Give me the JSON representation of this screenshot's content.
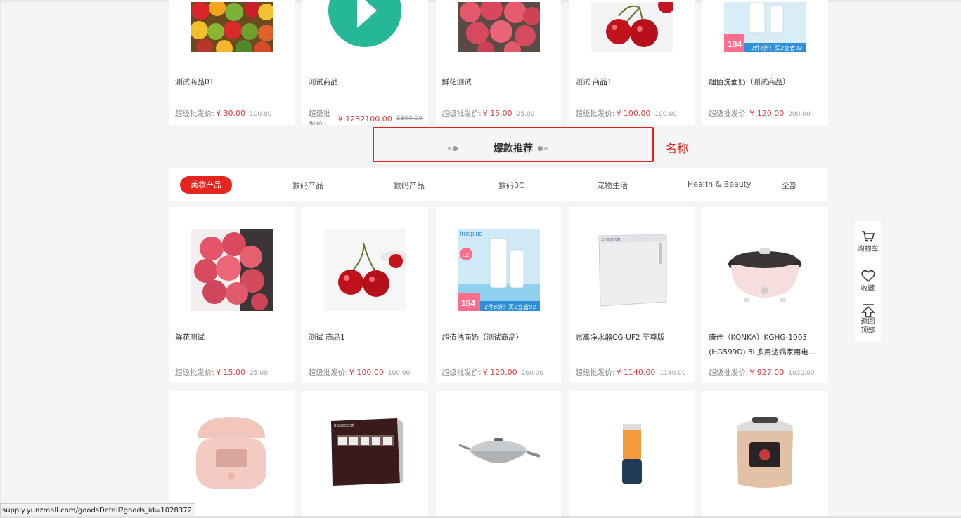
{
  "section": {
    "title": "爆款推荐",
    "annotation": "名称"
  },
  "tabs": [
    "美妆产品",
    "数码产品",
    "数码产品",
    "数码3C",
    "宠物生活",
    "Health & Beauty",
    "全部"
  ],
  "top_products": [
    {
      "name": "测试商品01",
      "label": "超级批发价:",
      "price": "¥ 30.00",
      "old": "100.00",
      "image": "fruits"
    },
    {
      "name": "测试商品",
      "label": "超级批发价:",
      "price": "¥ 1232100.00",
      "old": "1300.00",
      "image": "play-icon"
    },
    {
      "name": "鲜花测试",
      "label": "超级批发价:",
      "price": "¥ 15.00",
      "old": "25.00",
      "image": "flowers"
    },
    {
      "name": "测试 商品1",
      "label": "超级批发价:",
      "price": "¥ 100.00",
      "old": "100.00",
      "image": "cherries"
    },
    {
      "name": "超值洗面奶（测试商品）",
      "label": "超级批发价:",
      "price": "¥ 120.00",
      "old": "200.00",
      "image": "cleanser"
    }
  ],
  "recommended": [
    {
      "name": "鲜花测试",
      "label": "超级批发价:",
      "price": "¥ 15.00",
      "old": "25.00",
      "image": "flowers"
    },
    {
      "name": "测试 商品1",
      "label": "超级批发价:",
      "price": "¥ 100.00",
      "old": "100.00",
      "image": "cherries"
    },
    {
      "name": "超值洗面奶（测试商品）",
      "label": "超级批发价:",
      "price": "¥ 120.00",
      "old": "200.00",
      "image": "cleanser"
    },
    {
      "name": "志高净水器CG-UF2 至尊版",
      "label": "超级批发价:",
      "price": "¥ 1140.00",
      "old": "1140.00",
      "image": "water-purifier"
    },
    {
      "name": "康佳（KONKA）KGHG-1003 (HG599D) 3L多用途锅家用电...",
      "label": "超级批发价:",
      "price": "¥ 927.00",
      "old": "1030.00",
      "image": "electric-pot"
    }
  ],
  "bottom_products": [
    {
      "image": "rice-cooker"
    },
    {
      "image": "water-filter"
    },
    {
      "image": "wok"
    },
    {
      "image": "juicer"
    },
    {
      "image": "pressure-cooker"
    }
  ],
  "image_labels": {
    "cleanser_brand": "freeplus",
    "cleanser_badge1": "92",
    "cleanser_price": "184",
    "cleanser_promo": "2件8折！买2立省92",
    "purifier_brand": "CHIGO志高",
    "filter_brand": "BONGO志高"
  },
  "sidebar": {
    "cart": "购物车",
    "favorite": "收藏",
    "back_top_1": "返回",
    "back_top_2": "顶部"
  },
  "statusbar": {
    "url": "supply.yunzmall.com/goodsDetail?goods_id=1028372"
  },
  "colors": {
    "accent": "#e7251f",
    "price": "#e4393c",
    "highlight_border": "#e0201b"
  }
}
